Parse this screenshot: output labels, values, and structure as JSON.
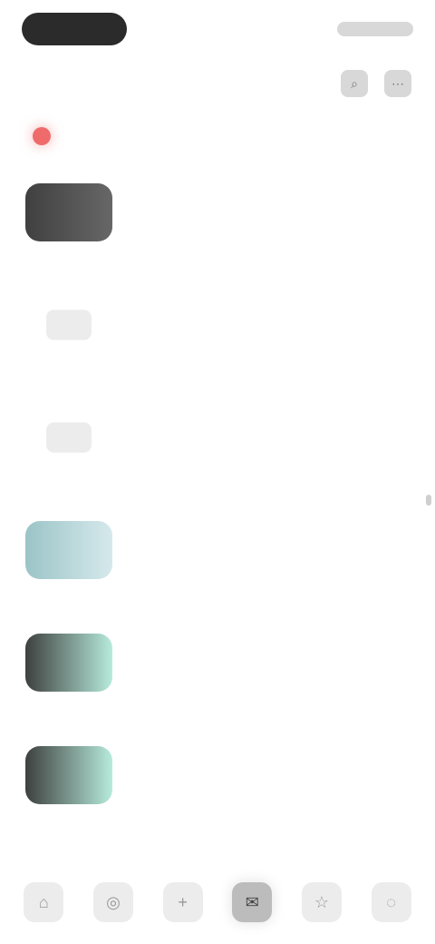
{
  "status_bar": {},
  "header": {
    "title": "",
    "actions": [
      {
        "name": "search-icon",
        "label": "⌕"
      },
      {
        "name": "more-icon",
        "label": "⋯"
      }
    ]
  },
  "tabs": {
    "label": "",
    "badge": "",
    "right_label": ""
  },
  "items": [
    {
      "title": "",
      "meta": "",
      "thumb": "dark"
    },
    {
      "title": "",
      "meta": "",
      "thumb": "light"
    },
    {
      "title": "",
      "meta": "",
      "thumb": "light"
    },
    {
      "title": "",
      "meta": "",
      "thumb": "teal"
    },
    {
      "title": "",
      "meta": "",
      "thumb": "dark-teal"
    },
    {
      "title": "",
      "meta": "",
      "thumb": "dark-teal"
    }
  ],
  "bottom_nav": {
    "items": [
      {
        "name": "nav-home",
        "icon": "⌂",
        "active": false
      },
      {
        "name": "nav-explore",
        "icon": "◎",
        "active": false
      },
      {
        "name": "nav-add",
        "icon": "+",
        "active": false
      },
      {
        "name": "nav-inbox",
        "icon": "✉",
        "active": true
      },
      {
        "name": "nav-bookmarks",
        "icon": "☆",
        "active": false
      },
      {
        "name": "nav-profile",
        "icon": "◌",
        "active": false
      }
    ]
  },
  "colors": {
    "accent": "#ef6b6b",
    "muted": "#d8d8d8"
  }
}
